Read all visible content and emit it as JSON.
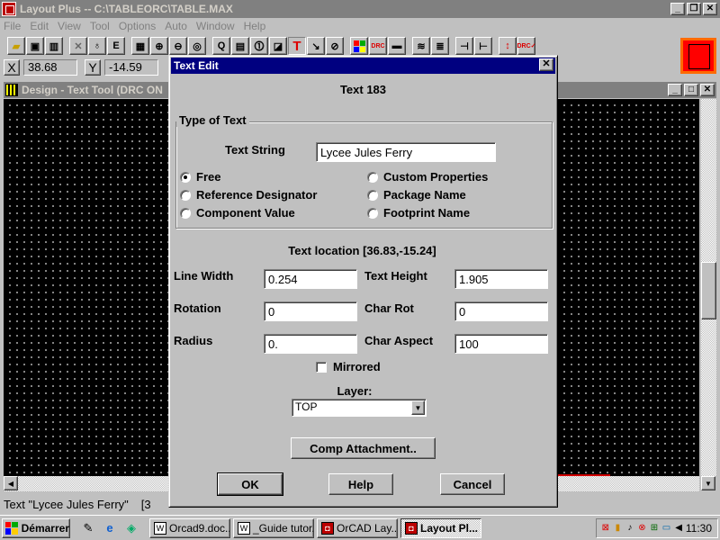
{
  "app": {
    "title": "Layout Plus -- C:\\TABLEORC\\TABLE.MAX",
    "menu": [
      "File",
      "Edit",
      "View",
      "Tool",
      "Options",
      "Auto",
      "Window",
      "Help"
    ]
  },
  "coords": {
    "x_label": "X",
    "x_value": "38.68",
    "y_label": "Y",
    "y_value": "-14.59"
  },
  "design_window": {
    "title": "Design - Text Tool (DRC ON"
  },
  "status_text": "Text \"Lycee Jules Ferry\"",
  "status_extra": "[3",
  "dialog": {
    "title": "Text Edit",
    "heading": "Text 183",
    "type_group_label": "Type of Text",
    "text_string_label": "Text String",
    "text_string_value": "Lycee Jules Ferry",
    "types_left": [
      "Free",
      "Reference Designator",
      "Component Value"
    ],
    "types_right": [
      "Custom Properties",
      "Package Name",
      "Footprint Name"
    ],
    "selected_type": "Free",
    "location": "Text location [36.83,-15.24]",
    "line_width_label": "Line Width",
    "line_width_value": "0.254",
    "text_height_label": "Text Height",
    "text_height_value": "1.905",
    "rotation_label": "Rotation",
    "rotation_value": "0",
    "char_rot_label": "Char Rot",
    "char_rot_value": "0",
    "radius_label": "Radius",
    "radius_value": "0.",
    "char_aspect_label": "Char Aspect",
    "char_aspect_value": "100",
    "mirrored_label": "Mirrored",
    "mirrored_checked": false,
    "layer_label": "Layer:",
    "layer_value": "TOP",
    "comp_attachment_label": "Comp Attachment..",
    "ok_label": "OK",
    "help_label": "Help",
    "cancel_label": "Cancel"
  },
  "taskbar": {
    "start_label": "Démarrer",
    "tasks": [
      {
        "label": "Orcad9.doc...",
        "icon": "word-icon",
        "active": false
      },
      {
        "label": "_Guide tutor...",
        "icon": "word-icon",
        "active": false
      },
      {
        "label": "OrCAD Lay...",
        "icon": "orcad-icon",
        "active": false
      },
      {
        "label": "Layout Pl...",
        "icon": "layout-icon",
        "active": true
      }
    ],
    "clock": "11:30"
  },
  "colors": {
    "dialog_title": "#000080",
    "canvas": "#000000",
    "inactive_title": "#808080"
  }
}
